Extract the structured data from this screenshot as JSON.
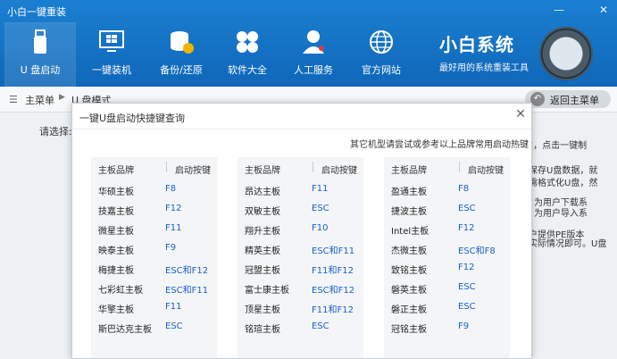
{
  "window": {
    "title": "小白一键重装",
    "min_label": "—",
    "close_label": "✕"
  },
  "nav": [
    {
      "label": "U 盘启动",
      "icon": "usb-drive-icon"
    },
    {
      "label": "一键装机",
      "icon": "windows-monitor-icon"
    },
    {
      "label": "备份/还原",
      "icon": "backup-restore-icon"
    },
    {
      "label": "软件大全",
      "icon": "software-grid-icon"
    },
    {
      "label": "人工服务",
      "icon": "service-person-icon"
    },
    {
      "label": "官方网站",
      "icon": "globe-icon"
    }
  ],
  "brand": {
    "title": "小白系统",
    "subtitle": "最好用的系统重装工具"
  },
  "breadcrumb": {
    "root": "主菜单",
    "current": "U 盘模式",
    "back_label": "返回主菜单"
  },
  "page": {
    "select_label": "请选择:"
  },
  "bg_fragments": [
    "”，点击一键制",
    "保存U盘数据，就",
    "需格式化U盘，然",
    "为用户下载系",
    "为用户导入系",
    "户提供PE版本",
    "实际情况即可。U盘"
  ],
  "dialog": {
    "title": "一键U盘启动快捷键查询",
    "close_label": "✕",
    "note": "其它机型请尝试或参考以上品牌常用启动热键",
    "columns": [
      {
        "header_brand": "主板品牌",
        "header_key": "启动按键",
        "rows": [
          {
            "brand": "华硕主板",
            "key": "F8"
          },
          {
            "brand": "技嘉主板",
            "key": "F12"
          },
          {
            "brand": "微星主板",
            "key": "F11"
          },
          {
            "brand": "映泰主板",
            "key": "F9"
          },
          {
            "brand": "梅捷主板",
            "key": "ESC和F12"
          },
          {
            "brand": "七彩虹主板",
            "key": "ESC和F11"
          },
          {
            "brand": "华擎主板",
            "key": "F11"
          },
          {
            "brand": "斯巴达克主板",
            "key": "ESC"
          }
        ]
      },
      {
        "header_brand": "主板品牌",
        "header_key": "启动按键",
        "rows": [
          {
            "brand": "昂达主板",
            "key": "F11"
          },
          {
            "brand": "双敏主板",
            "key": "ESC"
          },
          {
            "brand": "翔升主板",
            "key": "F10"
          },
          {
            "brand": "精英主板",
            "key": "ESC和F11"
          },
          {
            "brand": "冠盟主板",
            "key": "F11和F12"
          },
          {
            "brand": "富士康主板",
            "key": "ESC和F12"
          },
          {
            "brand": "顶星主板",
            "key": "F11和F12"
          },
          {
            "brand": "铭瑄主板",
            "key": "ESC"
          }
        ]
      },
      {
        "header_brand": "主板品牌",
        "header_key": "启动按键",
        "rows": [
          {
            "brand": "盈通主板",
            "key": "F8"
          },
          {
            "brand": "捷波主板",
            "key": "ESC"
          },
          {
            "brand": "Intel主板",
            "key": "F12"
          },
          {
            "brand": "杰微主板",
            "key": "ESC和F8"
          },
          {
            "brand": "致铭主板",
            "key": "F12"
          },
          {
            "brand": "磐英主板",
            "key": "ESC"
          },
          {
            "brand": "磐正主板",
            "key": "ESC"
          },
          {
            "brand": "冠铭主板",
            "key": "F9"
          }
        ]
      }
    ]
  },
  "colors": {
    "header_blue": "#1575c8",
    "key_blue": "#1a61c8"
  }
}
